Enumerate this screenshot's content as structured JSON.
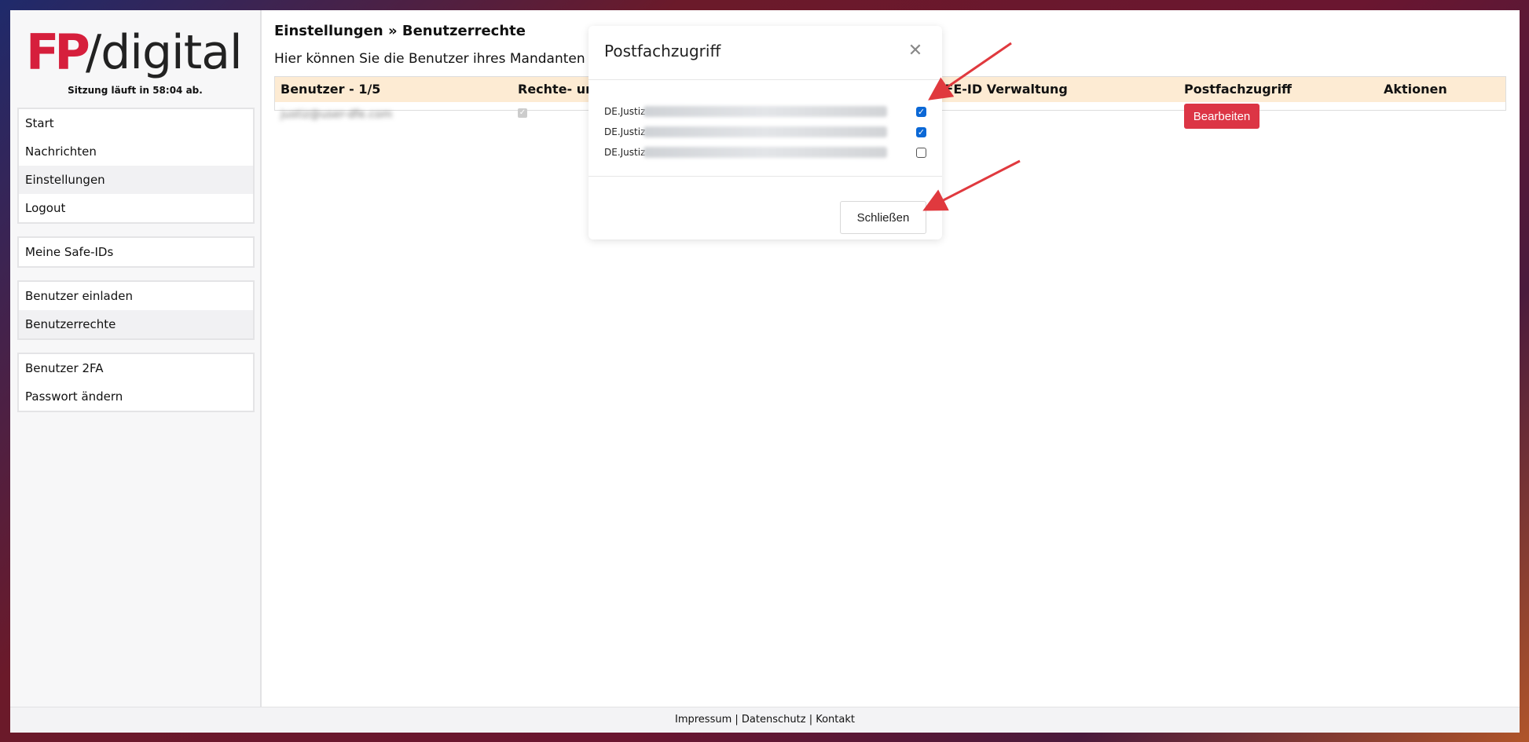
{
  "logo": {
    "mark": "FP",
    "text": "/digital"
  },
  "session": {
    "text": "Sitzung läuft in 58:04 ab."
  },
  "nav": {
    "group1": [
      "Start",
      "Nachrichten",
      "Einstellungen",
      "Logout"
    ],
    "group2": [
      "Meine Safe-IDs"
    ],
    "group3": [
      "Benutzer einladen",
      "Benutzerrechte"
    ],
    "group4": [
      "Benutzer 2FA",
      "Passwort ändern"
    ]
  },
  "page": {
    "title": "Einstellungen » Benutzerrechte",
    "description": "Hier können Sie die Benutzer ihres Mandanten bea"
  },
  "table": {
    "headers": [
      "Benutzer - 1/5",
      "Rechte- un",
      "AFE-ID Verwaltung",
      "Postfachzugriff",
      "Aktionen"
    ],
    "row": {
      "user": "justiz@user-dfe.com",
      "edit_label": "Bearbeiten"
    }
  },
  "modal": {
    "title": "Postfachzugriff",
    "items": [
      {
        "label": "DE.Justiz",
        "checked": true
      },
      {
        "label": "DE.Justiz",
        "checked": true
      },
      {
        "label": "DE.Justiz",
        "checked": false
      }
    ],
    "close_label": "Schließen"
  },
  "footer": {
    "impressum": "Impressum",
    "datenschutz": "Datenschutz",
    "kontakt": "Kontakt",
    "separator": " | "
  },
  "colors": {
    "brand": "#d61f3c",
    "table_header": "#fdebd3",
    "danger": "#dc3545",
    "checkbox": "#0b68d6",
    "arrow": "#e0393e"
  }
}
